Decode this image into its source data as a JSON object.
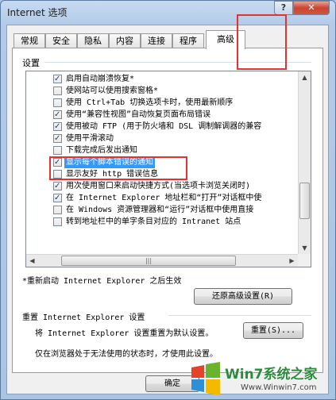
{
  "window": {
    "title": "Internet 选项",
    "help": "?",
    "close": "✕"
  },
  "tabs": [
    "常规",
    "安全",
    "隐私",
    "内容",
    "连接",
    "程序",
    "高级"
  ],
  "settings_label": "设置",
  "list_items": [
    {
      "checked": true,
      "label": "启用自动崩溃恢复*"
    },
    {
      "checked": false,
      "label": "使网站可以使用搜索窗格*"
    },
    {
      "checked": false,
      "label": "使用 Ctrl+Tab 切换选项卡时，使用最新顺序"
    },
    {
      "checked": true,
      "label": "使用“兼容性视图”自动恢复页面布局错误"
    },
    {
      "checked": true,
      "label": "使用被动 FTP (用于防火墙和 DSL 调制解调器的兼容"
    },
    {
      "checked": true,
      "label": "使用平滑滚动"
    },
    {
      "checked": false,
      "label": "下载完成后发出通知"
    },
    {
      "checked": true,
      "label": "显示每个脚本错误的通知",
      "selected": true
    },
    {
      "checked": false,
      "label": "显示友好 http 错误信息"
    },
    {
      "checked": true,
      "label": "用次使用窗口来启动快捷方式(当选项卡浏览关闭时)"
    },
    {
      "checked": true,
      "label": "在 Internet Explorer 地址栏和“打开”对话框中使"
    },
    {
      "checked": false,
      "label": "在 Windows 资源管理器和“运行”对话框中使用直接"
    },
    {
      "checked": false,
      "label": "转到地址栏中的单字条目对应的 Intranet 站点"
    }
  ],
  "note": "*重新启动 Internet Explorer 之后生效",
  "restore_button": "还原高级设置(R)",
  "reset_section": {
    "title": "重置 Internet Explorer 设置",
    "desc": "将 Internet Explorer 设置重置为默认设置。",
    "button": "重置(S)...",
    "warning": "仅在浏览器处于无法使用的状态时，才使用此设置。"
  },
  "ok_button": "确定",
  "watermark": {
    "text": "Win7系统之家",
    "url": "Www.Winwin7.com"
  },
  "colors": {
    "highlight_box": "#e23232",
    "selection": "#3399ff"
  }
}
